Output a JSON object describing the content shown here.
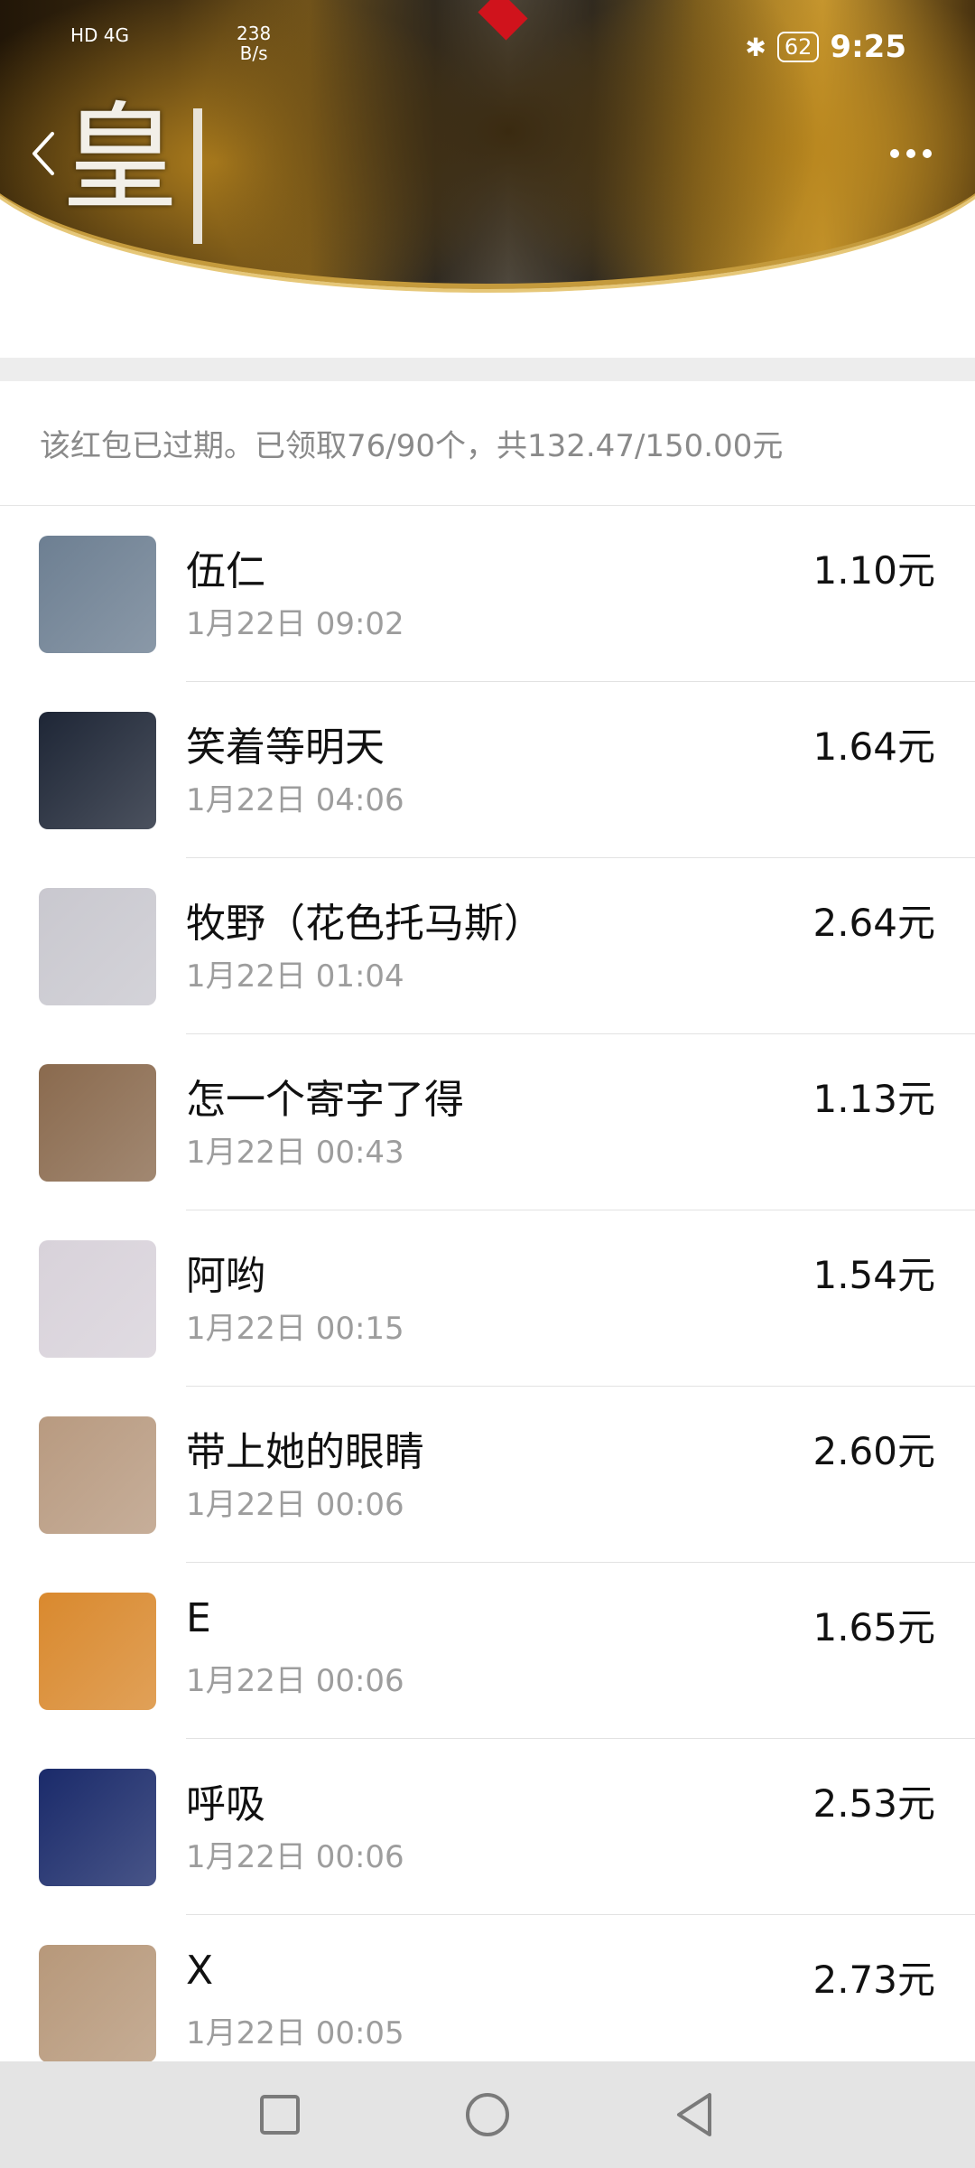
{
  "status_bar": {
    "network_left": "HD 4G",
    "speed_value": "238",
    "speed_unit": "B/s",
    "bluetooth_icon": "bluetooth-icon",
    "battery": "62",
    "time": "9:25"
  },
  "header": {
    "banner_text": "皇",
    "back_icon": "chevron-left-icon",
    "more_icon": "more-dots-icon"
  },
  "summary": "该红包已过期。已领取76/90个，共132.47/150.00元",
  "list": [
    {
      "name": "伍仁",
      "time": "1月22日  09:02",
      "amount": "1.10元",
      "avatar": "#6d7f92"
    },
    {
      "name": "笑着等明天",
      "time": "1月22日  04:06",
      "amount": "1.64元",
      "avatar": "#1e2636"
    },
    {
      "name": "牧野（花色托马斯）",
      "time": "1月22日  01:04",
      "amount": "2.64元",
      "avatar": "#c9c8cf"
    },
    {
      "name": "怎一个寄字了得",
      "time": "1月22日  00:43",
      "amount": "1.13元",
      "avatar": "#8a6a4e"
    },
    {
      "name": "阿哟",
      "time": "1月22日  00:15",
      "amount": "1.54元",
      "avatar": "#d8d2da"
    },
    {
      "name": "带上她的眼睛",
      "time": "1月22日  00:06",
      "amount": "2.60元",
      "avatar": "#b89a80"
    },
    {
      "name": "E",
      "time": "1月22日  00:06",
      "amount": "1.65元",
      "avatar": "#d9892e"
    },
    {
      "name": "呼吸",
      "time": "1月22日  00:06",
      "amount": "2.53元",
      "avatar": "#1a2a6a"
    },
    {
      "name": "X",
      "time": "1月22日  00:05",
      "amount": "2.73元",
      "avatar": "#b7987a"
    }
  ],
  "navbar": {
    "recent_icon": "square-icon",
    "home_icon": "circle-icon",
    "back_icon": "triangle-back-icon"
  }
}
